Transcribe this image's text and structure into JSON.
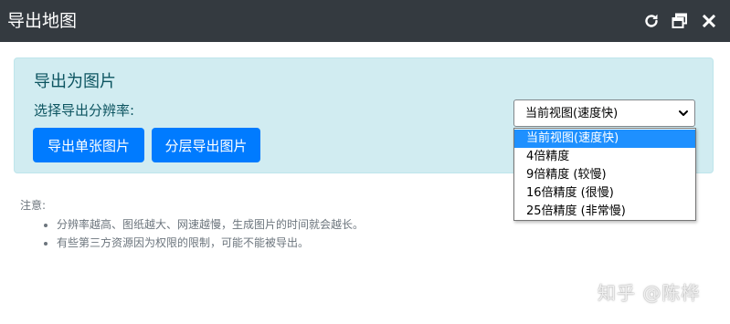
{
  "window": {
    "title": "导出地图",
    "controls": [
      "refresh-icon",
      "maximize-icon",
      "close-icon"
    ],
    "title_bg": "#343a40"
  },
  "panel": {
    "title": "导出为图片",
    "resolution_label": "选择导出分辨率:",
    "bg": "#d1ecf1",
    "buttons": {
      "single": "导出单张图片",
      "layered": "分层导出图片"
    },
    "button_color": "#007bff"
  },
  "resolution_select": {
    "selected": "当前视图(速度快)",
    "options": [
      "当前视图(速度快)",
      "4倍精度",
      "9倍精度 (较慢)",
      "16倍精度 (很慢)",
      "25倍精度 (非常慢)"
    ],
    "highlight_color": "#1e90ff"
  },
  "notes": {
    "heading": "注意:",
    "items": [
      "分辨率越高、图纸越大、网速越慢，生成图片的时间就会越长。",
      "有些第三方资源因为权限的限制，可能不能被导出。"
    ]
  },
  "watermark": "知乎 @陈桦"
}
